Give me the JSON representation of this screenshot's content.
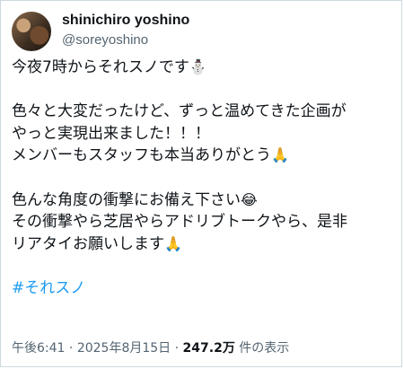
{
  "author": {
    "display_name": "shinichiro yoshino",
    "handle": "@soreyoshino"
  },
  "tweet": {
    "line1": "今夜7時からそれスノです",
    "line1_emoji": "⛄",
    "line2": "色々と大変だったけど、ずっと温めてきた企画が",
    "line3": "やっと実現出来ました！！！",
    "line4": "メンバーもスタッフも本当ありがとう",
    "line4_emoji": "🙏",
    "line5": "色んな角度の衝撃にお備え下さい",
    "line5_emoji": "😂",
    "line6": "その衝撃やら芝居やらアドリブトークやら、是非",
    "line7": "リアタイお願いします",
    "line7_emoji": "🙏",
    "hashtag": "#それスノ"
  },
  "meta": {
    "time": "午後6:41",
    "sep1": " · ",
    "date": "2025年8月15日",
    "sep2": " · ",
    "views": "247.2万",
    "views_label": " 件の表示"
  }
}
